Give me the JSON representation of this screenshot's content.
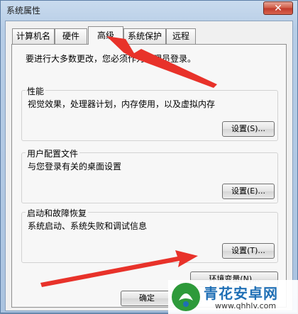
{
  "window": {
    "title": "系统属性",
    "close_glyph": "✕"
  },
  "tabs": [
    {
      "label": "计算机名",
      "active": false
    },
    {
      "label": "硬件",
      "active": false
    },
    {
      "label": "高级",
      "active": true
    },
    {
      "label": "系统保护",
      "active": false
    },
    {
      "label": "远程",
      "active": false
    }
  ],
  "advanced": {
    "admin_note": "要进行大多数更改，您必须作为管理员登录。",
    "performance": {
      "title": "性能",
      "description": "视觉效果，处理器计划，内存使用，以及虚拟内存",
      "button": "设置(S)..."
    },
    "user_profiles": {
      "title": "用户配置文件",
      "description": "与您登录有关的桌面设置",
      "button": "设置(E)..."
    },
    "startup_recovery": {
      "title": "启动和故障恢复",
      "description": "系统启动、系统失败和调试信息",
      "button": "设置(T)..."
    },
    "env_button": "环境变量(N)..."
  },
  "footer": {
    "ok_label": "确定"
  },
  "watermark": {
    "text": "青花安卓网",
    "url": "www.qhhlv.com"
  },
  "colors": {
    "annotation_arrow": "#e8322a",
    "watermark_blue": "#1f6fb5",
    "watermark_green": "#2e9a3a"
  }
}
